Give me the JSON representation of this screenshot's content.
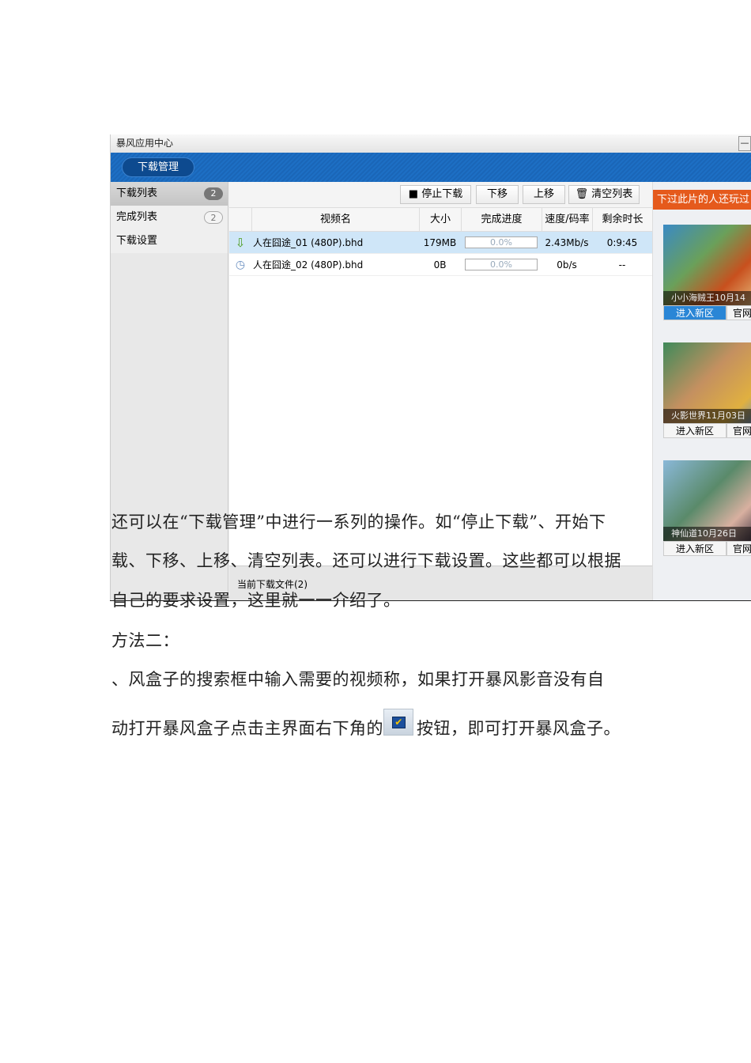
{
  "app": {
    "title": "暴风应用中心",
    "minimize": "—",
    "tab": "下载管理"
  },
  "sidebar": {
    "items": [
      {
        "label": "下载列表",
        "count": "2"
      },
      {
        "label": "完成列表",
        "count": "2"
      },
      {
        "label": "下载设置"
      }
    ]
  },
  "toolbar": {
    "stop": "■ 停止下载",
    "down": "下移",
    "up": "上移",
    "clear": "🗑 清空列表"
  },
  "table": {
    "headers": [
      "视频名",
      "大小",
      "完成进度",
      "速度/码率",
      "剩余时长"
    ],
    "rows": [
      {
        "name": "人在囧途_01 (480P).bhd",
        "size": "179MB",
        "progress": "0.0%",
        "speed": "2.43Mb/s",
        "remaining": "0:9:45",
        "icon": "download-arrow-icon"
      },
      {
        "name": "人在囧途_02 (480P).bhd",
        "size": "0B",
        "progress": "0.0%",
        "speed": "0b/s",
        "remaining": "--",
        "icon": "clock-icon"
      }
    ]
  },
  "status": "当前下载文件(2)",
  "ads": {
    "header": "下过此片的人还玩过：",
    "games": [
      {
        "caption": "小小海贼王10月14",
        "enter": "进入新区",
        "official": "官网"
      },
      {
        "caption": "火影世界11月03日",
        "enter": "进入新区",
        "official": "官网"
      },
      {
        "caption": "神仙道10月26日",
        "enter": "进入新区",
        "official": "官网"
      }
    ]
  },
  "doc": {
    "p1": "还可以在“下载管理”中进行一系列的操作。如“停止下载”、开始下",
    "p2": "载、下移、上移、清空列表。还可以进行下载设置。这些都可以根据",
    "p3": "自己的要求设置，这里就一一介绍了。",
    "p4": "方法二：",
    "p5": "、风盒子的搜索框中输入需要的视频称，如果打开暴风影音没有自",
    "p6a": "动打开暴风盒子点击主界面右下角的",
    "p6b": "按钮，即可打开暴风盒子。"
  }
}
